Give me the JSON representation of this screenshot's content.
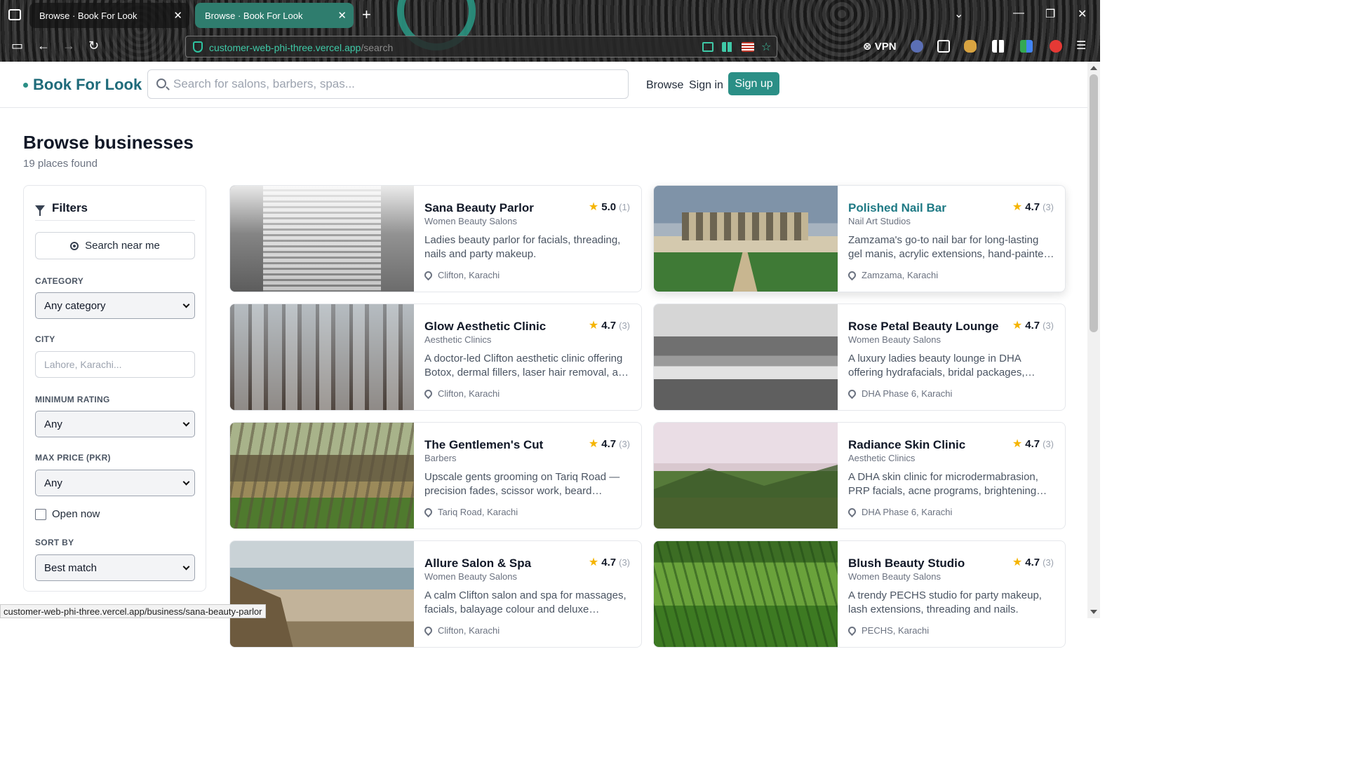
{
  "browser": {
    "tabs": [
      {
        "title": "Browse · Book For Look",
        "active": false
      },
      {
        "title": "Browse · Book For Look",
        "active": true
      }
    ],
    "url_host": "customer-web-phi-three.vercel.app",
    "url_path": "/search",
    "vpn_label": "VPN",
    "accent": "#2f7d6e"
  },
  "header": {
    "logo": "Book For Look",
    "search_placeholder": "Search for salons, barbers, spas...",
    "nav": {
      "browse": "Browse",
      "signin": "Sign in",
      "signup": "Sign up"
    },
    "brand_color": "#2b8f86"
  },
  "main": {
    "title": "Browse businesses",
    "subtitle": "19 places found"
  },
  "filters": {
    "title": "Filters",
    "near_me": "Search near me",
    "category_label": "CATEGORY",
    "category_value": "Any category",
    "city_label": "CITY",
    "city_placeholder": "Lahore, Karachi...",
    "rating_label": "MINIMUM RATING",
    "rating_value": "Any",
    "price_label": "MAX PRICE (PKR)",
    "price_value": "Any",
    "open_now": "Open now",
    "sort_label": "SORT BY",
    "sort_value": "Best match"
  },
  "businesses": [
    {
      "name": "Sana Beauty Parlor",
      "category": "Women Beauty Salons",
      "description": "Ladies beauty parlor for facials, threading, nails and party makeup.",
      "location": "Clifton, Karachi",
      "rating": "5.0",
      "count": "(1)"
    },
    {
      "name": "Polished Nail Bar",
      "category": "Nail Art Studios",
      "description": "Zamzama's go-to nail bar for long-lasting gel manis, acrylic extensions, hand-painted nail art and more.",
      "location": "Zamzama, Karachi",
      "rating": "4.7",
      "count": "(3)"
    },
    {
      "name": "Glow Aesthetic Clinic",
      "category": "Aesthetic Clinics",
      "description": "A doctor-led Clifton aesthetic clinic offering Botox, dermal fillers, laser hair removal, and more.",
      "location": "Clifton, Karachi",
      "rating": "4.7",
      "count": "(3)"
    },
    {
      "name": "Rose Petal Beauty Lounge",
      "category": "Women Beauty Salons",
      "description": "A luxury ladies beauty lounge in DHA offering hydrafacials, bridal packages, waxing, nails and more.",
      "location": "DHA Phase 6, Karachi",
      "rating": "4.7",
      "count": "(3)"
    },
    {
      "name": "The Gentlemen's Cut",
      "category": "Barbers",
      "description": "Upscale gents grooming on Tariq Road — precision fades, scissor work, beard sculpting and more.",
      "location": "Tariq Road, Karachi",
      "rating": "4.7",
      "count": "(3)"
    },
    {
      "name": "Radiance Skin Clinic",
      "category": "Aesthetic Clinics",
      "description": "A DHA skin clinic for microdermabrasion, PRP facials, acne programs, brightening peels and more.",
      "location": "DHA Phase 6, Karachi",
      "rating": "4.7",
      "count": "(3)"
    },
    {
      "name": "Allure Salon & Spa",
      "category": "Women Beauty Salons",
      "description": "A calm Clifton salon and spa for massages, facials, balayage colour and deluxe pedicures.",
      "location": "Clifton, Karachi",
      "rating": "4.7",
      "count": "(3)"
    },
    {
      "name": "Blush Beauty Studio",
      "category": "Women Beauty Salons",
      "description": "A trendy PECHS studio for party makeup, lash extensions, threading and nails.",
      "location": "PECHS, Karachi",
      "rating": "4.7",
      "count": "(3)"
    }
  ],
  "status_url": "customer-web-phi-three.vercel.app/business/sana-beauty-parlor"
}
